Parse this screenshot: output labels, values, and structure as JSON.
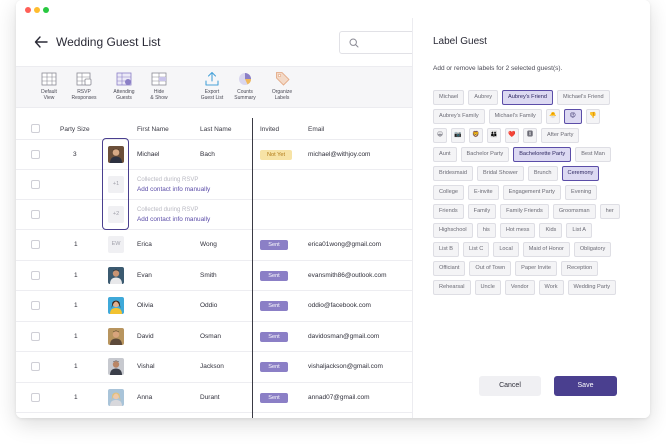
{
  "window": {
    "traffic_colors": [
      "#ff5f57",
      "#febc2e",
      "#28c840"
    ]
  },
  "header": {
    "title": "Wedding Guest List",
    "search_placeholder": ""
  },
  "toolbar": {
    "items": [
      {
        "label": "Default\nView",
        "icon": "grid-view-icon"
      },
      {
        "label": "RSVP\nResponses",
        "icon": "rsvp-table-icon"
      },
      {
        "label": "Attending\nGuests",
        "icon": "attending-table-icon"
      },
      {
        "label": "Hide\n& Show",
        "icon": "hide-show-table-icon"
      },
      {
        "label": "Export\nGuest List",
        "icon": "export-icon"
      },
      {
        "label": "Counts\nSummary",
        "icon": "pie-chart-icon"
      },
      {
        "label": "Organize\nLabels",
        "icon": "tag-icon"
      }
    ]
  },
  "table": {
    "columns": [
      "Party Size",
      "First Name",
      "Last Name",
      "Invited",
      "Email"
    ],
    "party_group": {
      "size": "3",
      "first": "Michael",
      "last": "Bach",
      "status": "Not Yet",
      "email": "michael@withjoy.com",
      "plus_ones": [
        {
          "badge": "+1",
          "note": "Collected during RSVP",
          "link": "Add contact info manually"
        },
        {
          "badge": "+2",
          "note": "Collected during RSVP",
          "link": "Add contact info manually"
        }
      ]
    },
    "rows": [
      {
        "size": "1",
        "initials": "EW",
        "first": "Erica",
        "last": "Wong",
        "status": "Sent",
        "email": "erica01wong@gmail.com"
      },
      {
        "size": "1",
        "initials": "",
        "first": "Evan",
        "last": "Smith",
        "status": "Sent",
        "email": "evansmith86@outlook.com"
      },
      {
        "size": "1",
        "initials": "",
        "first": "Olivia",
        "last": "Oddio",
        "status": "Sent",
        "email": "oddio@facebook.com"
      },
      {
        "size": "1",
        "initials": "",
        "first": "David",
        "last": "Osman",
        "status": "Sent",
        "email": "davidosman@gmail.com"
      },
      {
        "size": "1",
        "initials": "",
        "first": "Vishal",
        "last": "Jackson",
        "status": "Sent",
        "email": "vishaljackson@gmail.com"
      },
      {
        "size": "1",
        "initials": "",
        "first": "Anna",
        "last": "Durant",
        "status": "Sent",
        "email": "annad07@gmail.com"
      }
    ]
  },
  "panel": {
    "title": "Label Guest",
    "subtitle": "Add or remove labels for 2 selected guest(s).",
    "chip_rows": [
      [
        {
          "t": "Michael"
        },
        {
          "t": "Aubrey"
        },
        {
          "t": "Aubrey's Friend",
          "s": true
        },
        {
          "t": "Michael's Friend"
        }
      ],
      [
        {
          "t": "Aubrey's Family"
        },
        {
          "t": "Michael's Family"
        },
        {
          "t": "🐣",
          "e": true
        },
        {
          "t": "😍",
          "e": true,
          "s": true
        },
        {
          "t": "👎",
          "e": true
        }
      ],
      [
        {
          "t": "😀",
          "e": true
        },
        {
          "t": "📷",
          "e": true
        },
        {
          "t": "🦁",
          "e": true
        },
        {
          "t": "👪",
          "e": true
        },
        {
          "t": "❤️",
          "e": true
        },
        {
          "t": "🆇",
          "e": true
        },
        {
          "t": "After Party"
        }
      ],
      [
        {
          "t": "Aunt"
        },
        {
          "t": "Bachelor Party"
        },
        {
          "t": "Bachelorette Party",
          "s": true
        },
        {
          "t": "Best Man"
        }
      ],
      [
        {
          "t": "Bridesmaid"
        },
        {
          "t": "Bridal Shower"
        },
        {
          "t": "Brunch"
        },
        {
          "t": "Ceremony",
          "s": true
        }
      ],
      [
        {
          "t": "College"
        },
        {
          "t": "E-invite"
        },
        {
          "t": "Engagement Party"
        },
        {
          "t": "Evening"
        }
      ],
      [
        {
          "t": "Friends"
        },
        {
          "t": "Family"
        },
        {
          "t": "Family Friends"
        },
        {
          "t": "Groomsman"
        },
        {
          "t": "her"
        }
      ],
      [
        {
          "t": "Highschool"
        },
        {
          "t": "his"
        },
        {
          "t": "Hot mess"
        },
        {
          "t": "Kids"
        },
        {
          "t": "List A"
        }
      ],
      [
        {
          "t": "List B"
        },
        {
          "t": "List C"
        },
        {
          "t": "Local"
        },
        {
          "t": "Maid of Honor"
        },
        {
          "t": "Obligatory"
        }
      ],
      [
        {
          "t": "Officiant"
        },
        {
          "t": "Out of Town"
        },
        {
          "t": "Paper Invite"
        },
        {
          "t": "Reception"
        }
      ],
      [
        {
          "t": "Rehearsal"
        },
        {
          "t": "Uncle"
        },
        {
          "t": "Vendor"
        },
        {
          "t": "Work"
        },
        {
          "t": "Wedding Party"
        }
      ]
    ],
    "cancel_label": "Cancel",
    "save_label": "Save"
  },
  "colors": {
    "accent": "#4a3f8f",
    "sent": "#8b7fc6",
    "not_yet_bg": "#f7e3a6",
    "not_yet_text": "#b07a18",
    "chip_selected": "#dcd9f2"
  }
}
